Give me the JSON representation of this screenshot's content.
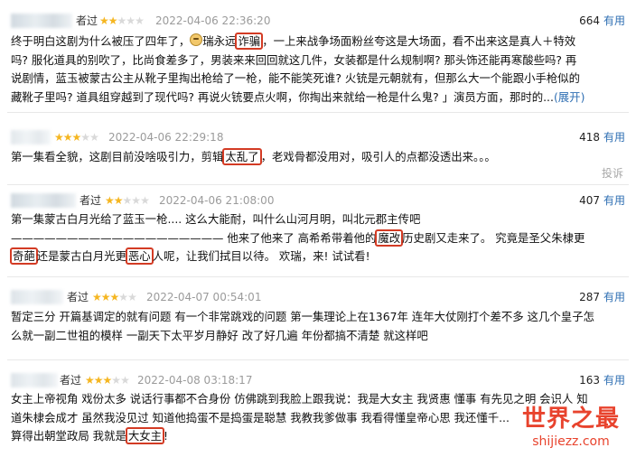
{
  "reviews": [
    {
      "name_tail": "者过",
      "rating": 2,
      "timestamp": "2022-04-06 22:36:20",
      "votes": "664",
      "useful_label": "有用",
      "lines": [
        [
          "终于明白这剧为什么被压了四年了，",
          "[emoji]",
          "瑞永远",
          "{诈骗}",
          "，一上来战争场面粉丝夸这是大场面，看不出来这是真人＋特效"
        ],
        [
          "吗? 服化道具的别吹了，比尚食差多了，男装来来回回就这几件，女装都是什么规制啊? 那头饰还能再寒酸些吗? 再"
        ],
        [
          "说剧情，蓝玉被蒙古公主从靴子里掏出枪给了一枪，能不能笑死谁? 火铳是元朝就有，但那么大一个能跟小手枪似的"
        ],
        [
          "藏靴子里吗? 道具组穿越到了现代吗? 再说火铳要点火啊，你掏出来就给一枪是什么鬼? 」演员方面，那时的...",
          "[expand]"
        ]
      ],
      "expand_label": "(展开)"
    },
    {
      "name_tail": "",
      "rating": 3,
      "timestamp": "2022-04-06 22:29:18",
      "votes": "418",
      "useful_label": "有用",
      "lines": [
        [
          "第一集看全貌，这剧目前没啥吸引力，剪辑",
          "{太乱了}",
          "，老戏骨都没用对，吸引人的点都没透出来。。。"
        ]
      ],
      "report_label": "投诉"
    },
    {
      "name_tail": "者过",
      "rating": 2,
      "timestamp": "2022-04-06 21:08:00",
      "votes": "407",
      "useful_label": "有用",
      "lines": [
        [
          "第一集蒙古白月光给了蓝玉一枪.... 这么大能耐，叫什么山河月明，叫北元郡主传吧"
        ],
        [
          "——————————————————— 他来了他来了 高希希带着他的",
          "{魔改}",
          "历史剧又走来了。 究竟是圣父朱棣更"
        ],
        [
          "{奇葩}",
          "还是蒙古白月光更",
          "{恶心}",
          "人呢，让我们拭目以待。 欢瑞，来! 试试看!"
        ]
      ]
    },
    {
      "name_tail": "者过",
      "rating": 3,
      "timestamp": "2022-04-07 00:54:01",
      "votes": "287",
      "useful_label": "有用",
      "lines": [
        [
          "暂定三分 开篇基调定的就有问题 有一个非常跳戏的问题 第一集理论上在1367年 连年大仗刚打个差不多 这几个皇子怎"
        ],
        [
          "么就一副二世祖的模样 一副天下太平岁月静好 改了好几遍 年份都搞不清楚 就这样吧"
        ]
      ]
    },
    {
      "name_tail": "者过",
      "rating": 3,
      "timestamp": "2022-04-08 03:18:17",
      "votes": "163",
      "useful_label": "有用",
      "lines": [
        [
          "女主上帝视角 戏份太多 说话行事都不合身份 仿佛跳到我脸上跟我说：我是大女主 我贤惠 懂事 有先见之明 会识人 知"
        ],
        [
          "道朱棣会成才 虽然我没见过 知道他捣蛋不是捣蛋是聪慧 我教我爹做事 我看得懂皇帝心思 我还懂千..."
        ],
        [
          "算得出朝堂政局 我就是",
          "{大女主}",
          "!"
        ]
      ]
    }
  ],
  "watermark": {
    "title": "世界之最",
    "url": "shijiezz.com"
  },
  "colors": {
    "star_on": "#f5b621",
    "star_off": "#d9d9d9",
    "highlight": "#d33b24",
    "link": "#2f6fb3"
  }
}
